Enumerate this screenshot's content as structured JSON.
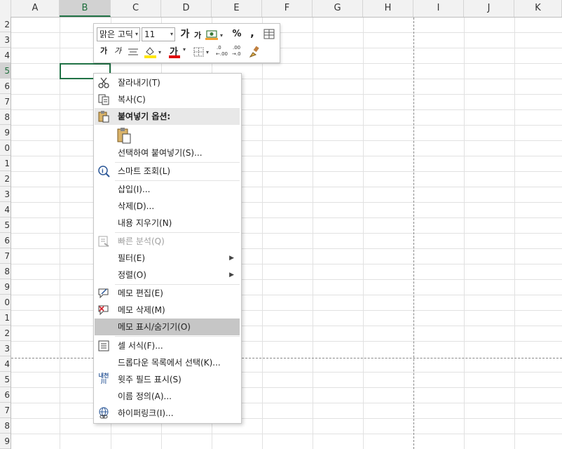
{
  "columns": [
    "A",
    "B",
    "C",
    "D",
    "E",
    "F",
    "G",
    "H",
    "I",
    "J",
    "K"
  ],
  "rows": [
    "2",
    "3",
    "4",
    "5",
    "6",
    "7",
    "8",
    "9",
    "0",
    "1",
    "2",
    "3",
    "4",
    "5",
    "6",
    "7",
    "8",
    "9",
    "0",
    "1",
    "2",
    "3",
    "4",
    "5",
    "6",
    "7",
    "8",
    "9"
  ],
  "selected_column": "B",
  "selected_row": "5",
  "mini_toolbar": {
    "font_name": "맑은 고딕",
    "font_size": "11",
    "grow_font": "가",
    "shrink_font": "가",
    "percent": "%",
    "comma": ",",
    "bold": "가",
    "italic": "가",
    "font_color": "가",
    "increase_decimal": ".00",
    "decrease_decimal": ".0"
  },
  "context_menu": {
    "items": [
      {
        "label": "잘라내기(T)",
        "icon": "scissors-icon"
      },
      {
        "label": "복사(C)",
        "icon": "copy-icon"
      },
      {
        "label": "붙여넣기 옵션:",
        "icon": "paste-icon",
        "header": true
      },
      {
        "label": "선택하여 붙여넣기(S)..."
      },
      {
        "label": "스마트 조회(L)",
        "icon": "smart-lookup-icon"
      },
      {
        "label": "삽입(I)..."
      },
      {
        "label": "삭제(D)..."
      },
      {
        "label": "내용 지우기(N)"
      },
      {
        "label": "빠른 분석(Q)",
        "icon": "quick-analysis-icon",
        "disabled": true
      },
      {
        "label": "필터(E)",
        "submenu": true
      },
      {
        "label": "정렬(O)",
        "submenu": true
      },
      {
        "label": "메모 편집(E)",
        "icon": "edit-note-icon"
      },
      {
        "label": "메모 삭제(M)",
        "icon": "delete-note-icon"
      },
      {
        "label": "메모 표시/숨기기(O)",
        "highlighted": true
      },
      {
        "label": "셀 서식(F)...",
        "icon": "format-cells-icon"
      },
      {
        "label": "드롭다운 목록에서 선택(K)..."
      },
      {
        "label": "윗주 필드 표시(S)",
        "icon": "phonetic-icon"
      },
      {
        "label": "이름 정의(A)..."
      },
      {
        "label": "하이퍼링크(I)...",
        "icon": "hyperlink-icon"
      }
    ]
  }
}
